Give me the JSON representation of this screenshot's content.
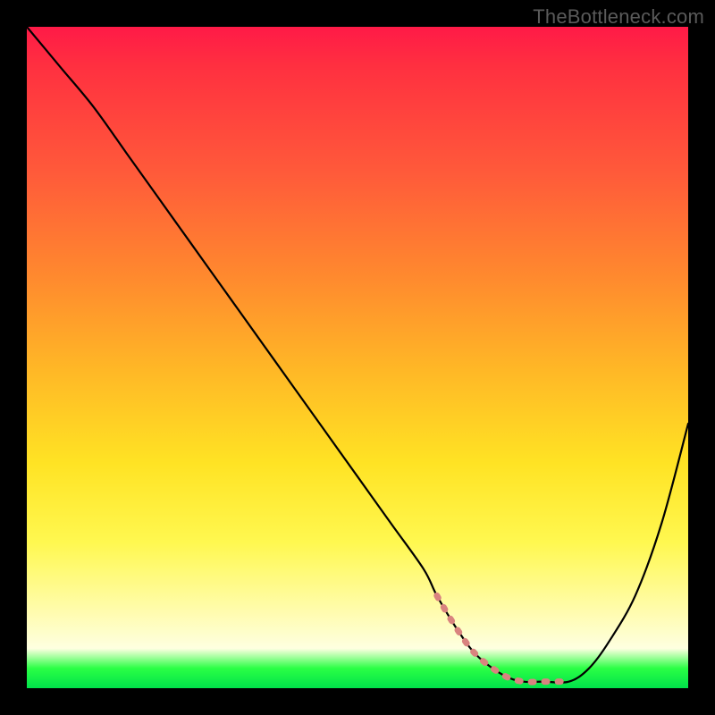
{
  "watermark": "TheBottleneck.com",
  "chart_data": {
    "type": "line",
    "title": "",
    "xlabel": "",
    "ylabel": "",
    "xlim": [
      0,
      100
    ],
    "ylim": [
      0,
      100
    ],
    "x": [
      0,
      5,
      10,
      15,
      20,
      25,
      30,
      35,
      40,
      45,
      50,
      55,
      60,
      62,
      65,
      68,
      72,
      75,
      78,
      82,
      85,
      88,
      92,
      96,
      100
    ],
    "values": [
      100,
      94,
      88,
      81,
      74,
      67,
      60,
      53,
      46,
      39,
      32,
      25,
      18,
      14,
      9,
      5,
      2,
      1,
      1,
      1,
      3,
      7,
      14,
      25,
      40
    ],
    "note": "Values are percentage heights read off the gradient; bottom ~0 is at green band, top ~100 at red. Curve descends from top-left, reaches minimum around x≈75–80, then rises toward right edge.",
    "marker_band": {
      "color": "#d9837f",
      "x_range": [
        62,
        83
      ],
      "y": 1,
      "description": "short dashed/dotted coral segment tracing the curve at its minimum"
    },
    "background_gradient_stops": [
      {
        "pos": 0,
        "color": "#ff1a47"
      },
      {
        "pos": 22,
        "color": "#ff5a3a"
      },
      {
        "pos": 52,
        "color": "#ffb826"
      },
      {
        "pos": 78,
        "color": "#fff850"
      },
      {
        "pos": 94,
        "color": "#feffe0"
      },
      {
        "pos": 100,
        "color": "#00e24a"
      }
    ]
  }
}
